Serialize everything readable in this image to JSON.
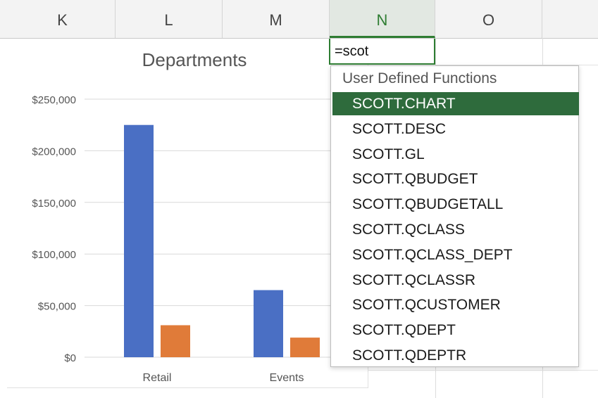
{
  "columns": [
    {
      "label": "K",
      "selected": false
    },
    {
      "label": "L",
      "selected": false
    },
    {
      "label": "M",
      "selected": false
    },
    {
      "label": "N",
      "selected": true
    },
    {
      "label": "O",
      "selected": false
    }
  ],
  "cell": {
    "formula": "=scot"
  },
  "autocomplete": {
    "header": "User Defined Functions",
    "items": [
      "SCOTT.CHART",
      "SCOTT.DESC",
      "SCOTT.GL",
      "SCOTT.QBUDGET",
      "SCOTT.QBUDGETALL",
      "SCOTT.QCLASS",
      "SCOTT.QCLASS_DEPT",
      "SCOTT.QCLASSR",
      "SCOTT.QCUSTOMER",
      "SCOTT.QDEPT",
      "SCOTT.QDEPTR"
    ],
    "selected_index": 0
  },
  "colors": {
    "accent_green": "#2e6b3c",
    "series_blue": "#4a6fc4",
    "series_orange": "#e07b39"
  },
  "chart_data": {
    "type": "bar",
    "title": "Departments",
    "categories": [
      "Retail",
      "Events"
    ],
    "series": [
      {
        "values": [
          225000,
          65000
        ],
        "color": "#4a6fc4"
      },
      {
        "values": [
          31000,
          19000
        ],
        "color": "#e07b39"
      }
    ],
    "yticks": [
      "$0",
      "$50,000",
      "$100,000",
      "$150,000",
      "$200,000",
      "$250,000"
    ],
    "ylim": [
      0,
      250000
    ],
    "grid": true
  }
}
